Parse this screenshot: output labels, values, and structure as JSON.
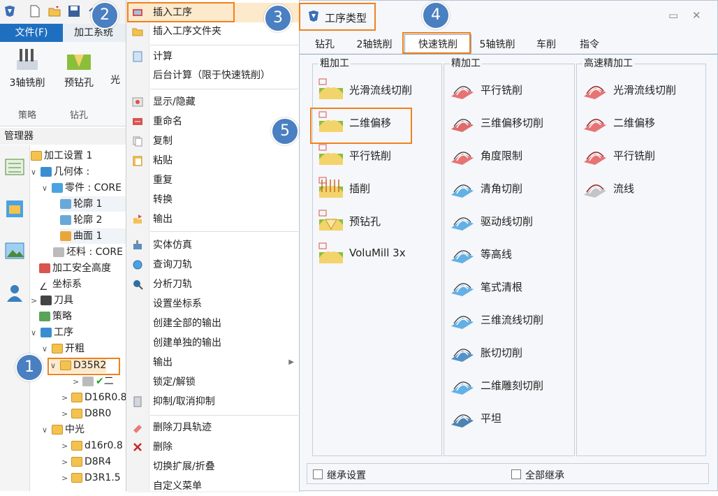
{
  "app": {
    "tabs": {
      "file": "文件(F)",
      "machining": "加工系统"
    },
    "ribbon": {
      "buttons": [
        "3轴铣削",
        "预钻孔",
        "光"
      ],
      "groups": [
        "策略",
        "钻孔"
      ]
    },
    "manager_title": "管理器",
    "tree": [
      {
        "label": "加工设置 1"
      },
      {
        "label": "几何体 :"
      },
      {
        "label": "零件 : CORE"
      },
      {
        "label": "轮廓 1"
      },
      {
        "label": "轮廓 2"
      },
      {
        "label": "曲面 1"
      },
      {
        "label": "坯料 : CORE"
      },
      {
        "label": "加工安全高度"
      },
      {
        "label": "坐标系"
      },
      {
        "label": "刀具"
      },
      {
        "label": "策略"
      },
      {
        "label": "工序"
      },
      {
        "label": "开粗"
      },
      {
        "label": "D35R2"
      },
      {
        "label": "二"
      },
      {
        "label": "D16R0.8"
      },
      {
        "label": "D8R0"
      },
      {
        "label": "中光"
      },
      {
        "label": "d16r0.8"
      },
      {
        "label": "D8R4"
      },
      {
        "label": "D3R1.5"
      }
    ]
  },
  "menu": {
    "items": [
      "插入工序",
      "插入工序文件夹",
      "计算",
      "后台计算（限于快速铣削）",
      "显示/隐藏",
      "重命名",
      "复制",
      "粘贴",
      "重复",
      "转换",
      "输出",
      "实体仿真",
      "查询刀轨",
      "分析刀轨",
      "设置坐标系",
      "创建全部的输出",
      "创建单独的输出",
      "输出",
      "锁定/解锁",
      "抑制/取消抑制",
      "删除刀具轨迹",
      "删除",
      "切换扩展/折叠",
      "自定义菜单"
    ]
  },
  "dialog": {
    "title": "工序类型",
    "tabs": [
      "钻孔",
      "2轴铣削",
      "快速铣削",
      "5轴铣削",
      "车削",
      "指令"
    ],
    "selected_tab": "快速铣削",
    "groups": [
      {
        "title": "粗加工",
        "items": [
          "光滑流线切削",
          "二维偏移",
          "平行铣削",
          "插削",
          "预钻孔",
          "VoluMill 3x"
        ]
      },
      {
        "title": "精加工",
        "items": [
          "平行铣削",
          "三维偏移切削",
          "角度限制",
          "清角切削",
          "驱动线切削",
          "等高线",
          "笔式清根",
          "三维流线切削",
          "胀切切削",
          "二维雕刻切削",
          "平坦"
        ]
      },
      {
        "title": "高速精加工",
        "items": [
          "光滑流线切削",
          "二维偏移",
          "平行铣削",
          "流线"
        ]
      }
    ],
    "footer": {
      "inherit_settings": "继承设置",
      "inherit_all": "全部继承"
    },
    "colors": {
      "accent": "#1f6fc0",
      "highlight": "#f0811e",
      "callout": "#4a7fc1"
    }
  },
  "callouts": [
    "1",
    "2",
    "3",
    "4",
    "5"
  ]
}
